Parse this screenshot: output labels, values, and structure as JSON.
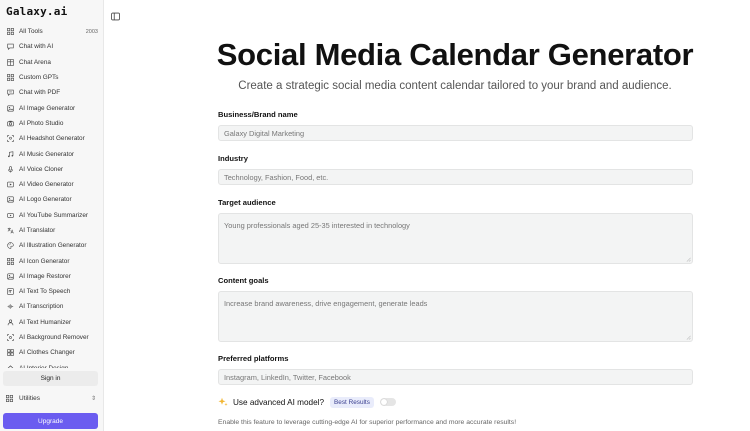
{
  "sidebar": {
    "brand": "Galaxy.ai",
    "items": [
      {
        "label": "All Tools",
        "icon": "grid-icon",
        "count": "2003"
      },
      {
        "label": "Chat with AI",
        "icon": "chat-icon"
      },
      {
        "label": "Chat Arena",
        "icon": "arena-icon"
      },
      {
        "label": "Custom GPTs",
        "icon": "grid-icon"
      },
      {
        "label": "Chat with PDF",
        "icon": "pdf-chat-icon"
      },
      {
        "label": "AI Image Generator",
        "icon": "image-icon"
      },
      {
        "label": "AI Photo Studio",
        "icon": "camera-icon"
      },
      {
        "label": "AI Headshot Generator",
        "icon": "scan-face-icon"
      },
      {
        "label": "AI Music Generator",
        "icon": "music-icon"
      },
      {
        "label": "AI Voice Cloner",
        "icon": "mic-icon"
      },
      {
        "label": "AI Video Generator",
        "icon": "video-icon"
      },
      {
        "label": "AI Logo Generator",
        "icon": "image-icon"
      },
      {
        "label": "AI YouTube Summarizer",
        "icon": "youtube-icon"
      },
      {
        "label": "AI Translator",
        "icon": "translate-icon"
      },
      {
        "label": "AI Illustration Generator",
        "icon": "palette-icon"
      },
      {
        "label": "AI Icon Generator",
        "icon": "grid-icon"
      },
      {
        "label": "AI Image Restorer",
        "icon": "image-icon"
      },
      {
        "label": "AI Text To Speech",
        "icon": "speech-icon"
      },
      {
        "label": "AI Transcription",
        "icon": "transcription-icon"
      },
      {
        "label": "AI Text Humanizer",
        "icon": "humanizer-icon"
      },
      {
        "label": "AI Background Remover",
        "icon": "background-icon"
      },
      {
        "label": "AI Clothes Changer",
        "icon": "shirt-icon"
      },
      {
        "label": "AI Interior Design",
        "icon": "home-icon"
      }
    ],
    "signin_label": "Sign in",
    "utilities_label": "Utilities",
    "upgrade_label": "Upgrade"
  },
  "main": {
    "title": "Social Media Calendar Generator",
    "subtitle": "Create a strategic social media content calendar tailored to your brand and audience.",
    "fields": {
      "brand": {
        "label": "Business/Brand name",
        "placeholder": "Galaxy Digital Marketing"
      },
      "industry": {
        "label": "Industry",
        "placeholder": "Technology, Fashion, Food, etc."
      },
      "audience": {
        "label": "Target audience",
        "placeholder": "Young professionals aged 25-35 interested in technology"
      },
      "goals": {
        "label": "Content goals",
        "placeholder": "Increase brand awareness, drive engagement, generate leads"
      },
      "platforms": {
        "label": "Preferred platforms",
        "placeholder": "Instagram, LinkedIn, Twitter, Facebook"
      }
    },
    "advanced": {
      "label": "Use advanced AI model?",
      "badge": "Best Results",
      "enabled": false,
      "note": "Enable this feature to leverage cutting-edge AI for superior performance and more accurate results!"
    }
  },
  "colors": {
    "accent": "#6b5cf0",
    "badge_bg": "#e9ecfb",
    "field_bg": "#f3f4f4",
    "sidebar_bg": "#f7f7f7"
  }
}
